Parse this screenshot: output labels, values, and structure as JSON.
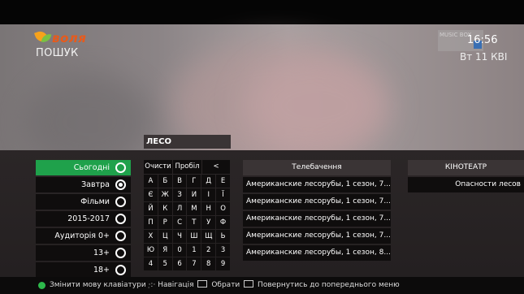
{
  "header": {
    "logo_text": "воля",
    "page_title": "ПОШУК",
    "time": "16:56",
    "date": "Вт 11 КВІ",
    "channel_logo_text": "MUSIC BOX"
  },
  "search": {
    "query": "ЛЕСО"
  },
  "filters": [
    {
      "label": "Сьогодні",
      "active": true,
      "selected": false
    },
    {
      "label": "Завтра",
      "active": false,
      "selected": true
    },
    {
      "label": "Фільми",
      "active": false,
      "selected": false
    },
    {
      "label": "2015-2017",
      "active": false,
      "selected": false
    },
    {
      "label": "Аудиторія 0+",
      "active": false,
      "selected": false
    },
    {
      "label": "13+",
      "active": false,
      "selected": false
    },
    {
      "label": "18+",
      "active": false,
      "selected": false
    }
  ],
  "keyboard": {
    "clear_label": "Очисти",
    "space_label": "Пробіл",
    "backspace_label": "<",
    "rows": [
      [
        "А",
        "Б",
        "В",
        "Г",
        "Д",
        "Е"
      ],
      [
        "Є",
        "Ж",
        "З",
        "И",
        "І",
        "Ї"
      ],
      [
        "Й",
        "К",
        "Л",
        "М",
        "Н",
        "О"
      ],
      [
        "П",
        "Р",
        "С",
        "Т",
        "У",
        "Ф"
      ],
      [
        "Х",
        "Ц",
        "Ч",
        "Ш",
        "Щ",
        "Ь"
      ],
      [
        "Ю",
        "Я",
        "0",
        "1",
        "2",
        "3"
      ],
      [
        "4",
        "5",
        "6",
        "7",
        "8",
        "9"
      ]
    ]
  },
  "tv_results": {
    "header": "Телебачення",
    "items": [
      "Американские лесорубы, 1 сезон, 7...",
      "Американские лесорубы, 1 сезон, 7...",
      "Американские лесорубы, 1 сезон, 7...",
      "Американские лесорубы, 1 сезон, 7...",
      "Американские лесорубы, 1 сезон, 8..."
    ]
  },
  "cinema_results": {
    "header": "КІНОТЕАТР",
    "items": [
      "Опасности лесов"
    ]
  },
  "bottom_bar": {
    "change_keyboard": "Змінити мову клавіатури",
    "navigation": "Навігація",
    "select": "Обрати",
    "back": "Повернутись до попереднього меню"
  },
  "colors": {
    "accent": "#1fa14b",
    "logo": "#e85a1b"
  }
}
